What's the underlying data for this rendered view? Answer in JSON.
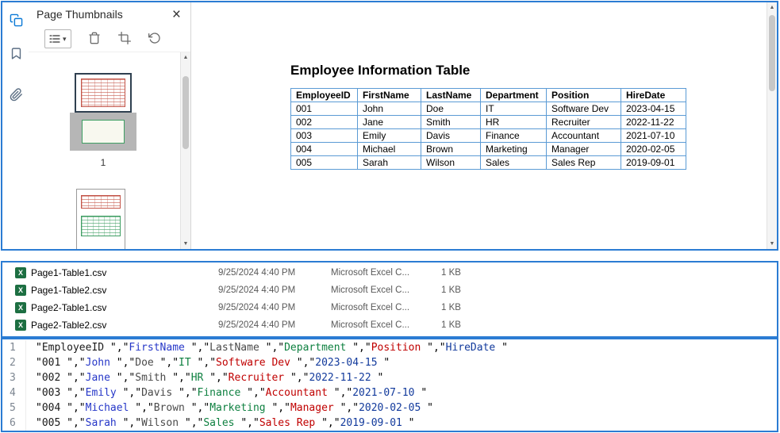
{
  "icons": {
    "close": "×",
    "caret_down": "▾",
    "collapse_left": "◀",
    "scroll_up": "▲",
    "scroll_down": "▼",
    "excel_letter": "X"
  },
  "colors": {
    "frame_blue": "#2b7cd3",
    "pdf_table_border": "#5b9bd5",
    "excel_green": "#1d6f42"
  },
  "pdf": {
    "panel_title": "Page Thumbnails",
    "page1_label": "1",
    "doc_title": "Employee Information Table",
    "table": {
      "headers": [
        "EmployeeID",
        "FirstName",
        "LastName",
        "Department",
        "Position",
        "HireDate"
      ],
      "rows": [
        [
          "001",
          "John",
          "Doe",
          "IT",
          "Software Dev",
          "2023-04-15"
        ],
        [
          "002",
          "Jane",
          "Smith",
          "HR",
          "Recruiter",
          "2022-11-22"
        ],
        [
          "003",
          "Emily",
          "Davis",
          "Finance",
          "Accountant",
          "2021-07-10"
        ],
        [
          "004",
          "Michael",
          "Brown",
          "Marketing",
          "Manager",
          "2020-02-05"
        ],
        [
          "005",
          "Sarah",
          "Wilson",
          "Sales",
          "Sales Rep",
          "2019-09-01"
        ]
      ]
    }
  },
  "files": {
    "rows": [
      {
        "name": "Page1-Table1.csv",
        "date": "9/25/2024 4:40 PM",
        "type": "Microsoft Excel C...",
        "size": "1 KB"
      },
      {
        "name": "Page1-Table2.csv",
        "date": "9/25/2024 4:40 PM",
        "type": "Microsoft Excel C...",
        "size": "1 KB"
      },
      {
        "name": "Page2-Table1.csv",
        "date": "9/25/2024 4:40 PM",
        "type": "Microsoft Excel C...",
        "size": "1 KB"
      },
      {
        "name": "Page2-Table2.csv",
        "date": "9/25/2024 4:40 PM",
        "type": "Microsoft Excel C...",
        "size": "1 KB"
      }
    ]
  },
  "editor": {
    "field_colors": [
      "#1a1a1a",
      "#2637c8",
      "#4a4a4a",
      "#0e8040",
      "#c00000",
      "#123a9c"
    ],
    "lines": [
      {
        "num": "1",
        "fields": [
          "EmployeeID ",
          "FirstName ",
          "LastName ",
          "Department ",
          "Position ",
          "HireDate "
        ]
      },
      {
        "num": "2",
        "fields": [
          "001 ",
          "John ",
          "Doe ",
          "IT ",
          "Software Dev ",
          "2023-04-15 "
        ]
      },
      {
        "num": "3",
        "fields": [
          "002 ",
          "Jane ",
          "Smith ",
          "HR ",
          "Recruiter ",
          "2022-11-22 "
        ]
      },
      {
        "num": "4",
        "fields": [
          "003 ",
          "Emily ",
          "Davis ",
          "Finance ",
          "Accountant ",
          "2021-07-10 "
        ]
      },
      {
        "num": "5",
        "fields": [
          "004 ",
          "Michael ",
          "Brown ",
          "Marketing ",
          "Manager ",
          "2020-02-05 "
        ]
      },
      {
        "num": "6",
        "fields": [
          "005 ",
          "Sarah ",
          "Wilson ",
          "Sales ",
          "Sales Rep ",
          "2019-09-01 "
        ]
      }
    ]
  }
}
